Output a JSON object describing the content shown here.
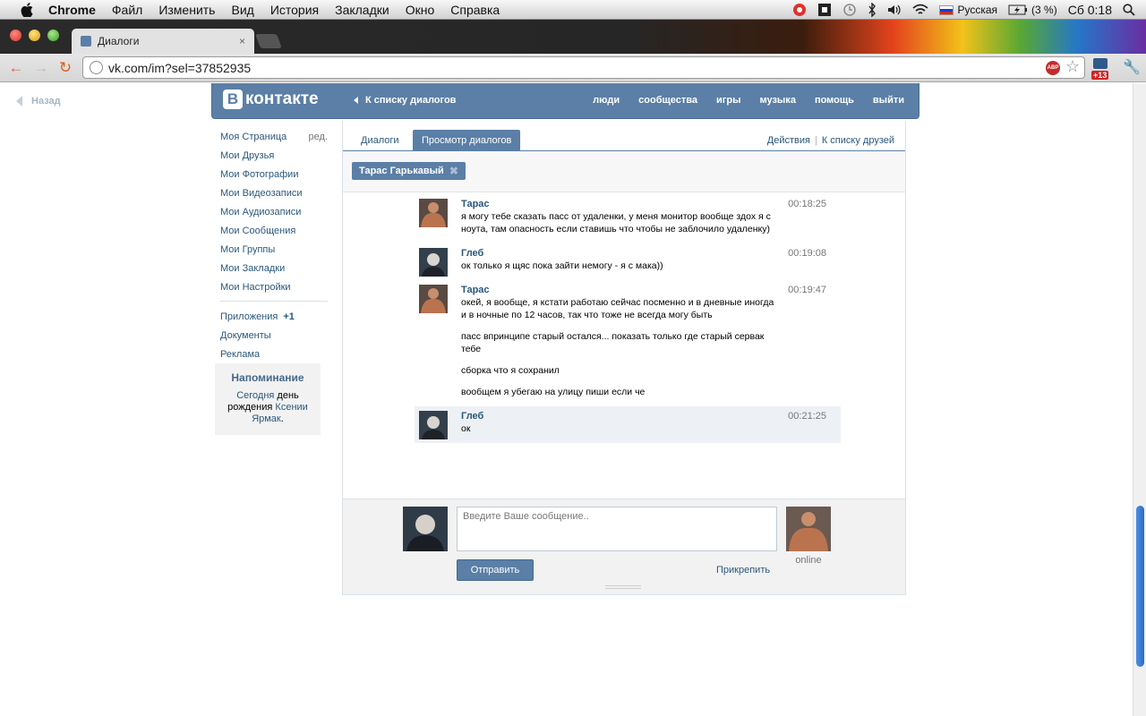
{
  "menubar": {
    "items": [
      "Chrome",
      "Файл",
      "Изменить",
      "Вид",
      "История",
      "Закладки",
      "Окно",
      "Справка"
    ],
    "keyboard_layout": "Русская",
    "battery": "(3 %)",
    "clock": "Сб 0:18"
  },
  "browser": {
    "tab_title": "Диалоги",
    "tab_close": "×",
    "url": "vk.com/im?sel=37852935",
    "abp_label": "ABP",
    "extension_badge": "+13",
    "back_icon": "←",
    "forward_icon": "→",
    "reload_icon": "↻",
    "star_icon": "☆",
    "wrench_icon": "🔧"
  },
  "page": {
    "back_label": "Назад"
  },
  "vk_header": {
    "logo_letter": "В",
    "logo_text": "контакте",
    "back_to_list": "К списку диалогов",
    "nav": [
      "люди",
      "сообщества",
      "игры",
      "музыка",
      "помощь",
      "выйти"
    ]
  },
  "sidebar": {
    "items": [
      {
        "label": "Моя Страница",
        "extra": "ред."
      },
      {
        "label": "Мои Друзья"
      },
      {
        "label": "Мои Фотографии"
      },
      {
        "label": "Мои Видеозаписи"
      },
      {
        "label": "Мои Аудиозаписи"
      },
      {
        "label": "Мои Сообщения"
      },
      {
        "label": "Мои Группы"
      },
      {
        "label": "Мои Закладки"
      },
      {
        "label": "Мои Настройки"
      }
    ],
    "extra_items": [
      {
        "label": "Приложения",
        "extra": "+1"
      },
      {
        "label": "Документы"
      },
      {
        "label": "Реклама"
      }
    ]
  },
  "reminder": {
    "title": "Напоминание",
    "today": "Сегодня",
    "text_middle": " день рождения ",
    "person": "Ксении Ярмак",
    "text_end": "."
  },
  "dialog": {
    "tabs": [
      "Диалоги",
      "Просмотр диалогов"
    ],
    "actions": "Действия",
    "friends_list": "К списку друзей",
    "chip_name": "Тарас Гарькавый",
    "chip_close": "✖"
  },
  "messages": [
    {
      "author": "Тарас",
      "time": "00:18:25",
      "texts": [
        "я могу тебе сказать пасс от удаленки, у меня монитор вообще здох я с ноута, там опасность если ставишь что чтобы не заблочило удаленку)"
      ]
    },
    {
      "author": "Глеб",
      "time": "00:19:08",
      "texts": [
        "ок только я щяс пока зайти немогу - я с мака))"
      ]
    },
    {
      "author": "Тарас",
      "time": "00:19:47",
      "texts": [
        "окей, я вообще, я кстати работаю сейчас посменно и в дневные иногда и в ночные по 12 часов, так что тоже не всегда могу быть",
        "пасс впринципе старый остался... показать только где старый сервак тебе",
        "сборка что я сохранил",
        "вообщем я убегаю на улицу пиши если че"
      ]
    },
    {
      "author": "Глеб",
      "time": "00:21:25",
      "texts": [
        "ок"
      ]
    }
  ],
  "composer": {
    "placeholder": "Введите Ваше сообщение..",
    "send_label": "Отправить",
    "attach_label": "Прикрепить",
    "status": "online"
  }
}
